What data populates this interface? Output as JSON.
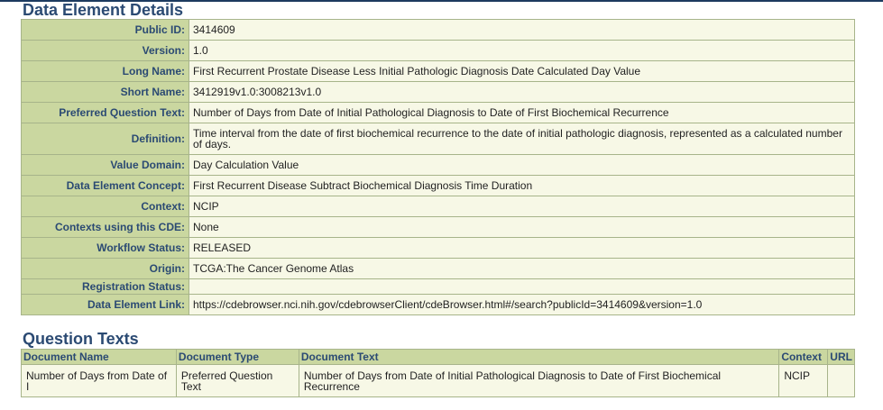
{
  "page": {
    "details_title": "Data Element Details",
    "question_title": "Question Texts"
  },
  "details": [
    {
      "label": "Public ID:",
      "value": "3414609"
    },
    {
      "label": "Version:",
      "value": "1.0"
    },
    {
      "label": "Long Name:",
      "value": "First Recurrent Prostate Disease Less Initial Pathologic Diagnosis Date Calculated Day Value"
    },
    {
      "label": "Short Name:",
      "value": "3412919v1.0:3008213v1.0"
    },
    {
      "label": "Preferred Question Text:",
      "value": "Number of Days from Date of Initial Pathological Diagnosis to Date of First Biochemical Recurrence"
    },
    {
      "label": "Definition:",
      "value": "Time interval from the date of first biochemical recurrence to the date of initial pathologic diagnosis, represented as a calculated number of days."
    },
    {
      "label": "Value Domain:",
      "value": "Day Calculation Value"
    },
    {
      "label": "Data Element Concept:",
      "value": "First Recurrent Disease Subtract Biochemical Diagnosis Time Duration"
    },
    {
      "label": "Context:",
      "value": "NCIP"
    },
    {
      "label": "Contexts using this CDE:",
      "value": "None"
    },
    {
      "label": "Workflow Status:",
      "value": "RELEASED"
    },
    {
      "label": "Origin:",
      "value": "TCGA:The Cancer Genome Atlas"
    },
    {
      "label": "Registration Status:",
      "value": ""
    },
    {
      "label": "Data Element Link:",
      "value": "https://cdebrowser.nci.nih.gov/cdebrowserClient/cdeBrowser.html#/search?publicId=3414609&version=1.0"
    }
  ],
  "questions": {
    "headers": [
      "Document Name",
      "Document Type",
      "Document Text",
      "Context",
      "URL"
    ],
    "rows": [
      [
        "Number of Days from Date of I",
        "Preferred Question Text",
        "Number of Days from Date of Initial Pathological Diagnosis to Date of First Biochemical Recurrence",
        "NCIP",
        ""
      ]
    ]
  }
}
